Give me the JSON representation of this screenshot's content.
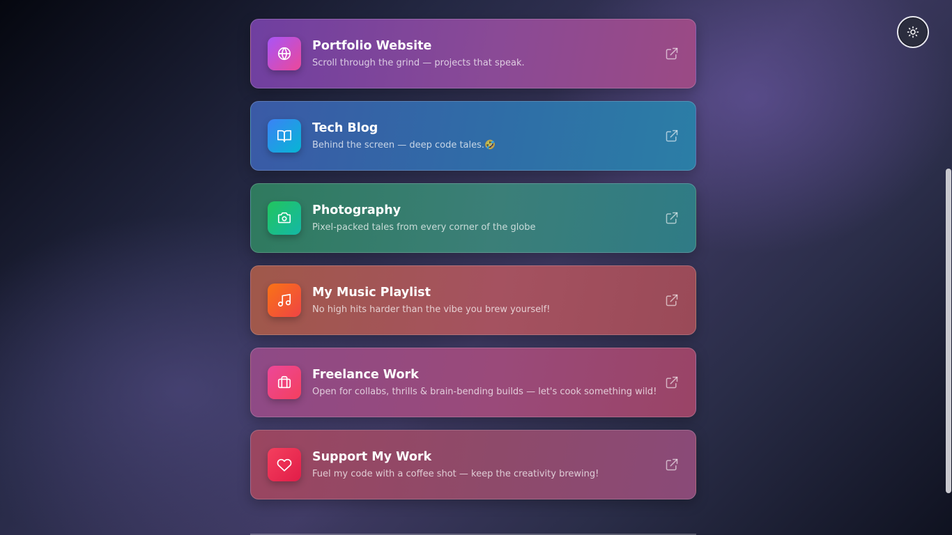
{
  "theme_toggle": {
    "icon": "sun-icon"
  },
  "links": [
    {
      "id": "portfolio",
      "title": "Portfolio Website",
      "description": "Scroll through the grind — projects that speak.",
      "icon": "globe-icon",
      "card_gradient": [
        "#6f3fa0",
        "#8a4a96",
        "#9b4a84"
      ],
      "icon_gradient": [
        "#a855f7",
        "#ec4899"
      ]
    },
    {
      "id": "tech-blog",
      "title": "Tech Blog",
      "description": "Behind the screen — deep code tales.🤣",
      "icon": "book-open-icon",
      "card_gradient": [
        "#3a5aa6",
        "#2f6da7",
        "#2b7ea6"
      ],
      "icon_gradient": [
        "#3b82f6",
        "#06b6d4"
      ]
    },
    {
      "id": "photography",
      "title": "Photography",
      "description": "Pixel-packed tales from every corner of the globe",
      "icon": "camera-icon",
      "card_gradient": [
        "#2f7a5e",
        "#3b7f78",
        "#2f7b86"
      ],
      "icon_gradient": [
        "#22c55e",
        "#14b8a6"
      ]
    },
    {
      "id": "music",
      "title": "My Music Playlist",
      "description": "No high hits harder than the vibe you brew yourself!",
      "icon": "music-icon",
      "card_gradient": [
        "#a0584a",
        "#a55260",
        "#9a4a58"
      ],
      "icon_gradient": [
        "#f97316",
        "#ef4444"
      ]
    },
    {
      "id": "freelance",
      "title": "Freelance Work",
      "description": "Open for collabs, thrills & brain-bending builds — let's cook something wild!",
      "icon": "briefcase-icon",
      "card_gradient": [
        "#8e4a86",
        "#9a4a7a",
        "#9a4466"
      ],
      "icon_gradient": [
        "#ec4899",
        "#f43f5e"
      ]
    },
    {
      "id": "support",
      "title": "Support My Work",
      "description": "Fuel my code with a coffee shot — keep the creativity brewing!",
      "icon": "heart-icon",
      "card_gradient": [
        "#9a4660",
        "#8e4a6a",
        "#8a4a78"
      ],
      "icon_gradient": [
        "#f43f5e",
        "#e11d48"
      ]
    }
  ]
}
